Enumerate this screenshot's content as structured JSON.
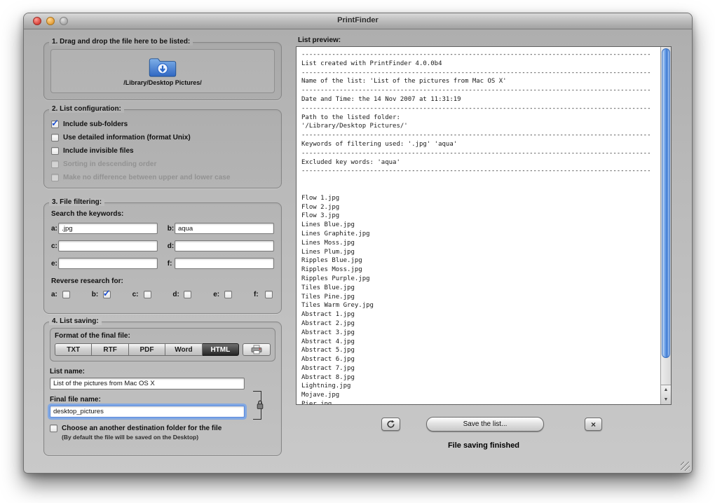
{
  "window": {
    "title": "PrintFinder"
  },
  "left": {
    "drop": {
      "title": "1. Drag and drop the file here to be listed:",
      "path": "/Library/Desktop Pictures/"
    },
    "config": {
      "title": "2. List configuration:",
      "options": [
        {
          "label": "Include sub-folders",
          "checked": true,
          "disabled": false
        },
        {
          "label": "Use detailed information (format Unix)",
          "checked": false,
          "disabled": false
        },
        {
          "label": "Include invisible files",
          "checked": false,
          "disabled": false
        },
        {
          "label": "Sorting in descending order",
          "checked": false,
          "disabled": true
        },
        {
          "label": "Make no difference between upper and lower case",
          "checked": false,
          "disabled": true
        }
      ]
    },
    "filtering": {
      "title": "3. File filtering:",
      "search_label": "Search the keywords:",
      "fields": [
        {
          "key": "a:",
          "value": ".jpg"
        },
        {
          "key": "b:",
          "value": "aqua"
        },
        {
          "key": "c:",
          "value": ""
        },
        {
          "key": "d:",
          "value": ""
        },
        {
          "key": "e:",
          "value": ""
        },
        {
          "key": "f:",
          "value": ""
        }
      ],
      "reverse_label": "Reverse research for:",
      "reverse": [
        {
          "key": "a:",
          "checked": false
        },
        {
          "key": "b:",
          "checked": true
        },
        {
          "key": "c:",
          "checked": false
        },
        {
          "key": "d:",
          "checked": false
        },
        {
          "key": "e:",
          "checked": false
        },
        {
          "key": "f:",
          "checked": false
        }
      ]
    },
    "saving": {
      "title": "4. List saving:",
      "format_label": "Format of the final file:",
      "formats": [
        {
          "label": "TXT",
          "selected": false
        },
        {
          "label": "RTF",
          "selected": false
        },
        {
          "label": "PDF",
          "selected": false
        },
        {
          "label": "Word",
          "selected": false
        },
        {
          "label": "HTML",
          "selected": true
        }
      ],
      "list_name_label": "List name:",
      "list_name": "List of the pictures from Mac OS X",
      "final_name_label": "Final file name:",
      "final_name": "desktop_pictures",
      "dest_label": "Choose an another destination folder for the file",
      "dest_note": "(By default the file will be saved on the Desktop)"
    }
  },
  "right": {
    "preview_label": "List preview:",
    "preview_text": "--------------------------------------------------------------------------------------------\nList created with PrintFinder 4.0.0b4\n--------------------------------------------------------------------------------------------\nName of the list: 'List of the pictures from Mac OS X'\n--------------------------------------------------------------------------------------------\nDate and Time: the 14 Nov 2007 at 11:31:19\n--------------------------------------------------------------------------------------------\nPath to the listed folder:\n'/Library/Desktop Pictures/'\n--------------------------------------------------------------------------------------------\nKeywords of filtering used: '.jpg' 'aqua'\n--------------------------------------------------------------------------------------------\nExcluded key words: 'aqua'\n--------------------------------------------------------------------------------------------\n\n\nFlow 1.jpg\nFlow 2.jpg\nFlow 3.jpg\nLines Blue.jpg\nLines Graphite.jpg\nLines Moss.jpg\nLines Plum.jpg\nRipples Blue.jpg\nRipples Moss.jpg\nRipples Purple.jpg\nTiles Blue.jpg\nTiles Pine.jpg\nTiles Warm Grey.jpg\nAbstract 1.jpg\nAbstract 2.jpg\nAbstract 3.jpg\nAbstract 4.jpg\nAbstract 5.jpg\nAbstract 6.jpg\nAbstract 7.jpg\nAbstract 8.jpg\nLightning.jpg\nMojave.jpg\nPier.jpg",
    "save_label": "Save the list...",
    "close_label": "×",
    "status": "File saving finished"
  },
  "colors": {
    "accent_blue": "#1d4fd0",
    "focus_ring": "#6ea0ee",
    "scrollbar_blue": "#3f7bd3",
    "selected_format_bg": "#262626"
  }
}
